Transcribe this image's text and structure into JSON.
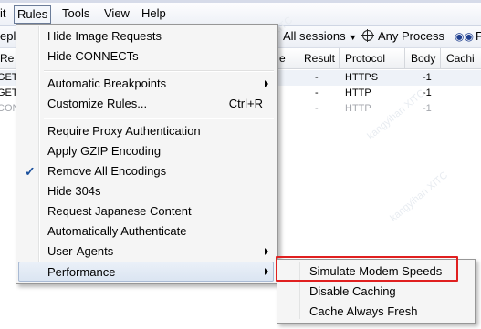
{
  "menubar": {
    "items": [
      {
        "label": "it",
        "active": false
      },
      {
        "label": "Rules",
        "active": true
      },
      {
        "label": "Tools",
        "active": false
      },
      {
        "label": "View",
        "active": false
      },
      {
        "label": "Help",
        "active": false
      }
    ]
  },
  "toolbar": {
    "left_fragment": "epl",
    "sessions_label": "All sessions",
    "process_label": "Any Process",
    "find_fragment": "Fi"
  },
  "columns": {
    "c0": "Re",
    "c1": "e",
    "result": "Result",
    "protocol": "Protocol",
    "body": "Body",
    "caching": "Cachi"
  },
  "sessions": [
    {
      "prefix": "GET",
      "result": "-",
      "protocol": "HTTPS",
      "body": "-1",
      "style": "normal"
    },
    {
      "prefix": "GET",
      "result": "-",
      "protocol": "HTTP",
      "body": "-1",
      "style": "normal"
    },
    {
      "prefix": "CON",
      "result": "-",
      "protocol": "HTTP",
      "body": "-1",
      "style": "gray"
    }
  ],
  "watermark": "kangyihan XITC",
  "rules_menu": {
    "items": [
      {
        "label": "Hide Image Requests"
      },
      {
        "label": "Hide CONNECTs"
      },
      {
        "label": "Automatic Breakpoints"
      },
      {
        "label": "Customize Rules...",
        "shortcut": "Ctrl+R"
      },
      {
        "label": "Require Proxy Authentication"
      },
      {
        "label": "Apply GZIP Encoding"
      },
      {
        "label": "Remove All Encodings"
      },
      {
        "label": "Hide 304s"
      },
      {
        "label": "Request Japanese Content"
      },
      {
        "label": "Automatically Authenticate"
      },
      {
        "label": "User-Agents"
      },
      {
        "label": "Performance"
      }
    ],
    "checkmark": "✓"
  },
  "performance_submenu": {
    "items": [
      {
        "label": "Simulate Modem Speeds"
      },
      {
        "label": "Disable Caching"
      },
      {
        "label": "Cache Always Fresh"
      }
    ]
  },
  "colors": {
    "highlight_box": "#e02020",
    "check": "#1a4f9c"
  }
}
